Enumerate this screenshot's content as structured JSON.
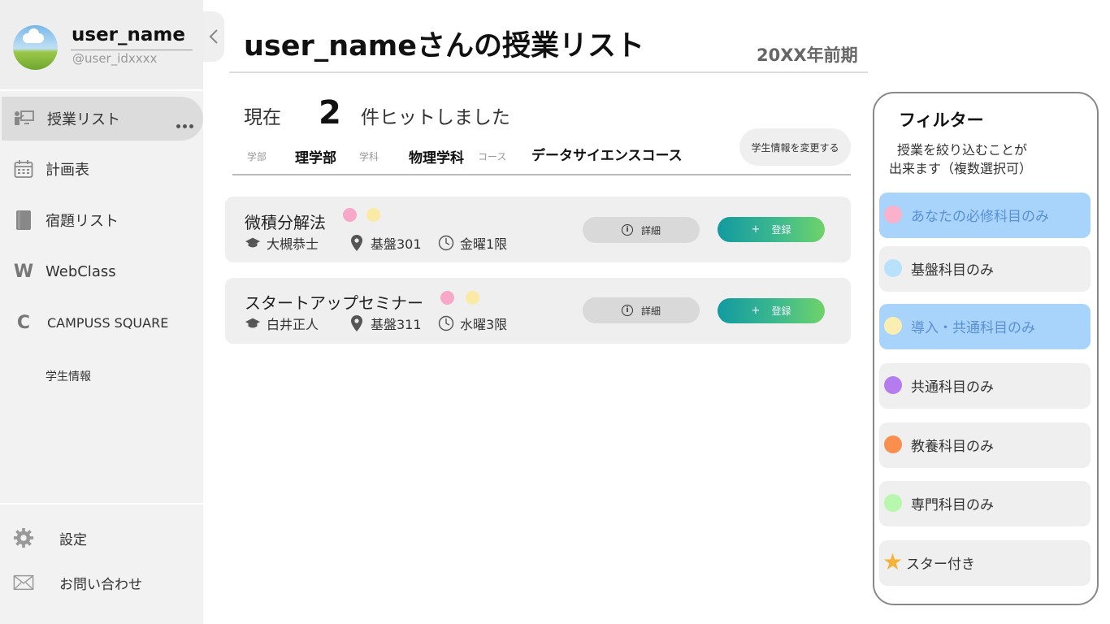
{
  "sidebar": {
    "user_name": "user_name",
    "user_id": "@user_idxxxx",
    "nav": [
      {
        "label": "授業リスト",
        "icon": "classroom-icon"
      },
      {
        "label": "計画表",
        "icon": "calendar-icon"
      },
      {
        "label": "宿題リスト",
        "icon": "book-icon"
      },
      {
        "label": "WebClass",
        "icon": "webclass-w-icon",
        "glyph": "W"
      },
      {
        "label": "CAMPUSS SQUARE",
        "icon": "campus-square-c-icon",
        "glyph": "C"
      },
      {
        "label": "学生情報"
      }
    ],
    "footer": [
      {
        "label": "設定",
        "icon": "gear-icon"
      },
      {
        "label": "お問い合わせ",
        "icon": "mail-icon"
      }
    ]
  },
  "header": {
    "title": "user_nameさんの授業リスト",
    "term": "20XX年前期"
  },
  "summary": {
    "prefix": "現在",
    "count": "2",
    "suffix": "件ヒットしました"
  },
  "student_info": {
    "faculty_label": "学部",
    "faculty": "理学部",
    "department_label": "学科",
    "department": "物理学科",
    "course_label": "コース",
    "course": "データサイエンスコース",
    "change_button": "学生情報を変更する"
  },
  "courses": [
    {
      "name": "微積分解法",
      "teacher": "大槻恭士",
      "room": "基盤301",
      "time": "金曜1限",
      "tag_colors": [
        "#f7a8c8",
        "#fbeaa6"
      ],
      "detail_label": "詳細",
      "register_label": "登録"
    },
    {
      "name": "スタートアップセミナー",
      "teacher": "白井正人",
      "room": "基盤311",
      "time": "水曜3限",
      "tag_colors": [
        "#f7a8c8",
        "#fbeaa6"
      ],
      "detail_label": "詳細",
      "register_label": "登録"
    }
  ],
  "filter": {
    "title": "フィルター",
    "description_line1": "授業を絞り込むことが",
    "description_line2": "出来ます（複数選択可）",
    "items": [
      {
        "label": "あなたの必修科目のみ",
        "color": "#f9b1cc",
        "selected": true
      },
      {
        "label": "基盤科目のみ",
        "color": "#b8e2fb",
        "selected": false
      },
      {
        "label": "導入・共通科目のみ",
        "color": "#fbeeb3",
        "selected": true
      },
      {
        "label": "共通科目のみ",
        "color": "#b57cf0",
        "selected": false
      },
      {
        "label": "教養科目のみ",
        "color": "#f98f4e",
        "selected": false
      },
      {
        "label": "専門科目のみ",
        "color": "#b8f7ae",
        "selected": false
      },
      {
        "label": "スター付き",
        "icon": "star-icon",
        "color": "#f4b237",
        "selected": false
      }
    ]
  },
  "colors": {
    "accent_gradient_start": "#129aa0",
    "accent_gradient_end": "#6fd36a",
    "selected_filter": "#a8d4fb"
  }
}
